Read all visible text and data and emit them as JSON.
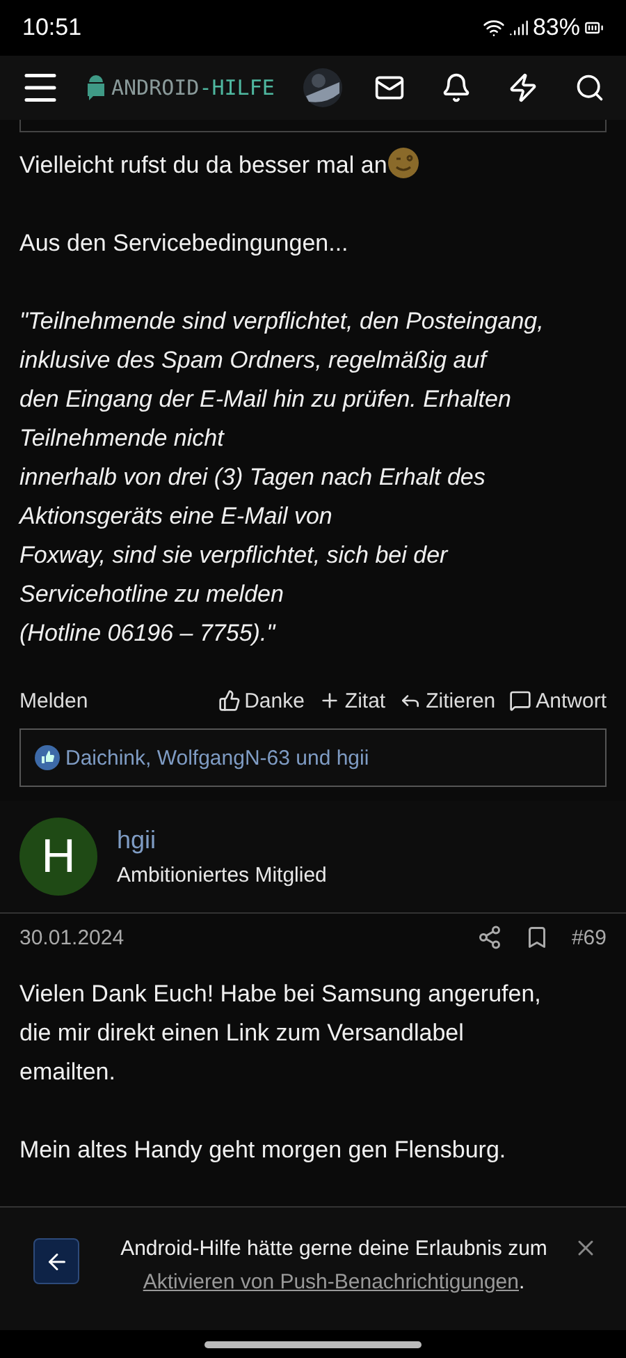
{
  "status_bar": {
    "time": "10:51",
    "battery": "83%"
  },
  "header": {
    "logo_prefix": "ANDROID",
    "logo_suffix": "-HILFE"
  },
  "posts": [
    {
      "paragraphs": [
        {
          "text": "Vielleicht rufst du da besser mal an",
          "emoji": true,
          "italic": false
        },
        {
          "text": "Aus den Servicebedingungen...",
          "emoji": false,
          "italic": false
        },
        {
          "text": "\"Teilnehmende sind verpflichtet, den Posteingang,\ninklusive des Spam Ordners, regelmäßig auf\nden Eingang der E-Mail hin zu prüfen. Erhalten\nTeilnehmende nicht\ninnerhalb von drei (3) Tagen nach Erhalt des\nAktionsgeräts eine E-Mail von\nFoxway, sind sie verpflichtet, sich bei der\nServicehotline zu melden\n(Hotline 06196 – 7755).\"",
          "emoji": false,
          "italic": true
        }
      ],
      "actions": {
        "report": "Melden",
        "thanks": "Danke",
        "quote_add": "Zitat",
        "quote": "Zitieren",
        "reply": "Antwort"
      },
      "reactions": "Daichink, WolfgangN-63 und hgii"
    },
    {
      "author": {
        "initial": "H",
        "name": "hgii",
        "rank": "Ambitioniertes Mitglied"
      },
      "date": "30.01.2024",
      "number": "#69",
      "paragraphs": [
        {
          "text": "Vielen Dank Euch! Habe bei Samsung angerufen,\ndie mir direkt einen Link zum Versandlabel\nemailten.",
          "emoji": false,
          "italic": false
        },
        {
          "text": "Mein altes Handy geht morgen gen Flensburg.",
          "emoji": false,
          "italic": false
        }
      ]
    }
  ],
  "banner": {
    "text": "Android-Hilfe hätte gerne deine Erlaubnis zum ",
    "link": "Aktivieren von Push-Benachrichtigungen",
    "end": "."
  }
}
